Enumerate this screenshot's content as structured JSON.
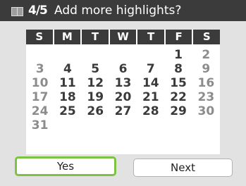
{
  "header": {
    "page_counter": "4/5",
    "prompt": "Add more highlights?"
  },
  "calendar": {
    "weekdays": [
      "S",
      "M",
      "T",
      "W",
      "T",
      "F",
      "S"
    ],
    "weeks": [
      [
        "",
        "",
        "",
        "",
        "",
        "1",
        "2"
      ],
      [
        "3",
        "4",
        "5",
        "6",
        "7",
        "8",
        "9"
      ],
      [
        "10",
        "11",
        "12",
        "13",
        "14",
        "15",
        "16"
      ],
      [
        "17",
        "18",
        "19",
        "20",
        "21",
        "22",
        "23"
      ],
      [
        "24",
        "25",
        "26",
        "27",
        "28",
        "29",
        "30"
      ],
      [
        "31",
        "",
        "",
        "",
        "",
        "",
        ""
      ]
    ]
  },
  "buttons": {
    "yes_label": "Yes",
    "next_label": "Next"
  },
  "colors": {
    "header_bg": "#3b3b3b",
    "selection_border": "#7dc242",
    "weekend_text": "#8c8c8c",
    "weekday_text": "#3a3a3a"
  }
}
